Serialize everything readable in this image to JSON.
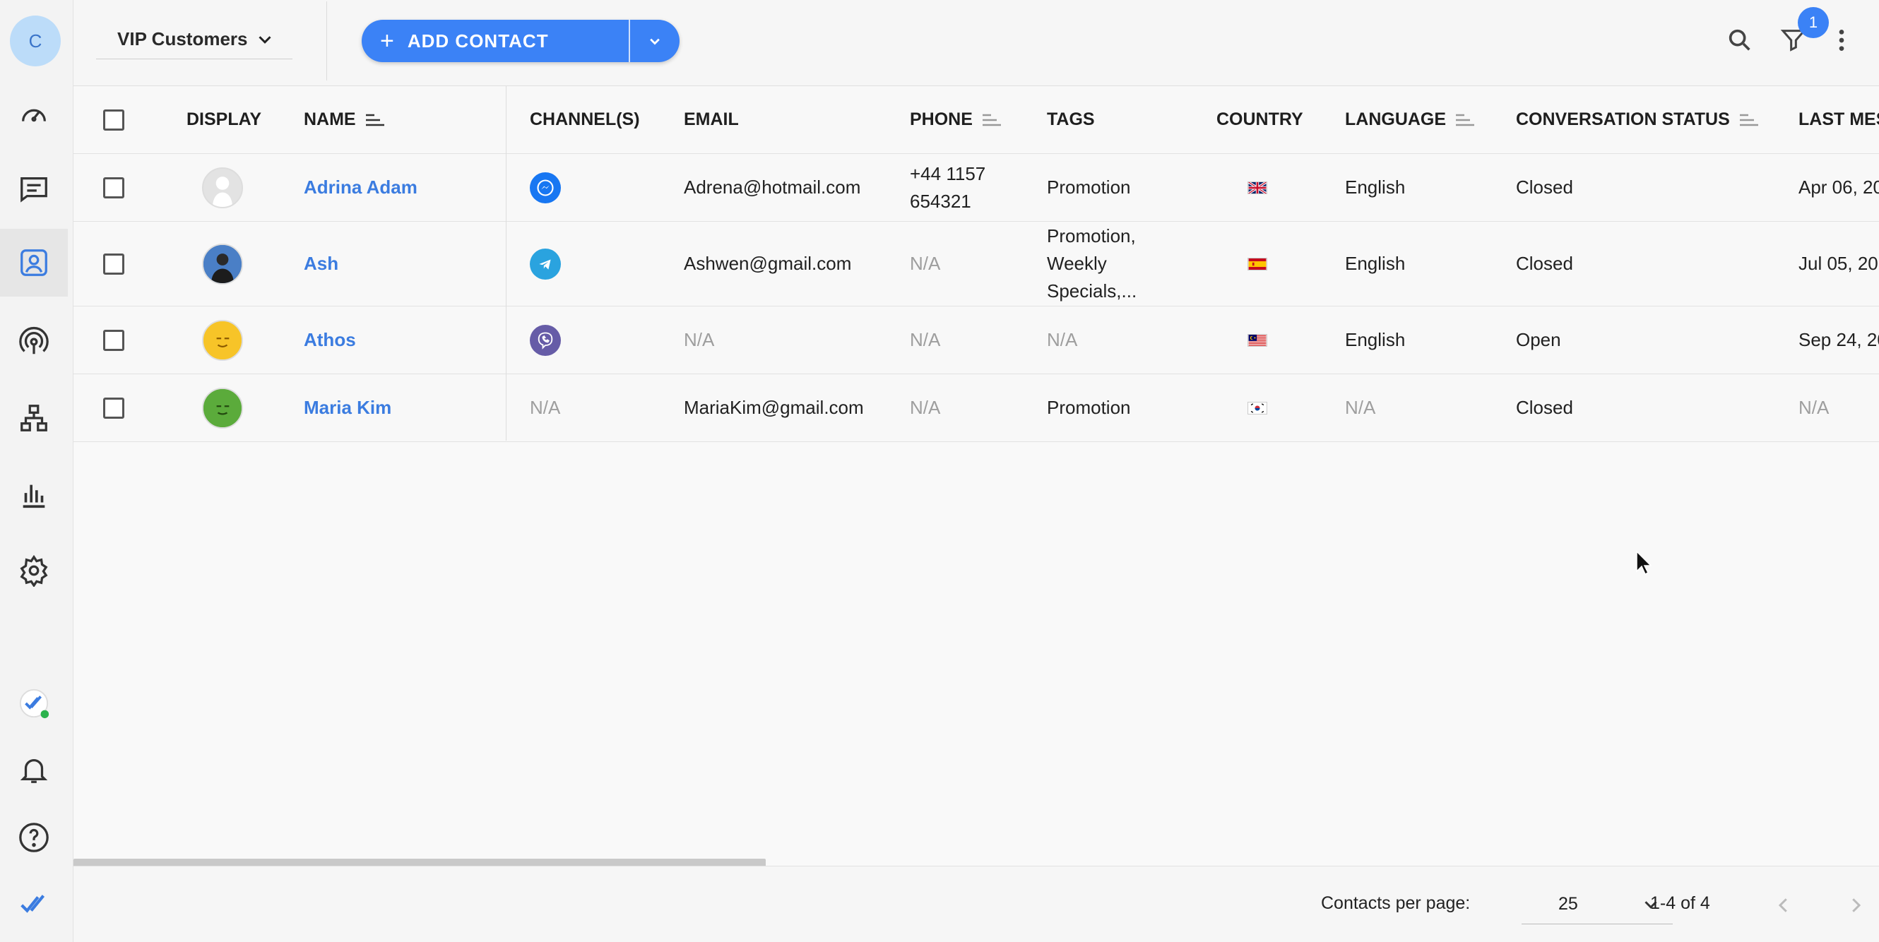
{
  "sidebar": {
    "avatar_initial": "C",
    "items": [
      "dashboard",
      "inbox",
      "contacts",
      "broadcasts",
      "workflows",
      "reports",
      "settings"
    ],
    "bottom": [
      "status",
      "notifications",
      "help",
      "brand"
    ]
  },
  "topbar": {
    "view_label": "VIP Customers",
    "add_contact_label": "ADD CONTACT",
    "filter_badge": "1"
  },
  "table": {
    "headers": {
      "display": "DISPLAY",
      "name": "NAME",
      "channels": "CHANNEL(S)",
      "email": "EMAIL",
      "phone": "PHONE",
      "tags": "TAGS",
      "country": "COUNTRY",
      "language": "LANGUAGE",
      "status": "CONVERSATION STATUS",
      "last": "LAST MES"
    },
    "rows": [
      {
        "name": "Adrina Adam",
        "channel": "messenger",
        "email": "Adrena@hotmail.com",
        "phone": "+44 1157 654321",
        "tags": "Promotion",
        "country": "gb",
        "language": "English",
        "status": "Closed",
        "last": "Apr 06, 20"
      },
      {
        "name": "Ash",
        "channel": "telegram",
        "email": "Ashwen@gmail.com",
        "phone": "N/A",
        "tags": "Promotion, Weekly Specials,...",
        "country": "es",
        "language": "English",
        "status": "Closed",
        "last": "Jul 05, 20"
      },
      {
        "name": "Athos",
        "channel": "viber",
        "email": "N/A",
        "phone": "N/A",
        "tags": "N/A",
        "country": "my",
        "language": "English",
        "status": "Open",
        "last": "Sep 24, 20"
      },
      {
        "name": "Maria Kim",
        "channel": "N/A",
        "email": "MariaKim@gmail.com",
        "phone": "N/A",
        "tags": "Promotion",
        "country": "kr",
        "language": "N/A",
        "status": "Closed",
        "last": "N/A"
      }
    ]
  },
  "footer": {
    "per_page_label": "Contacts per page:",
    "per_page_value": "25",
    "range": "1-4 of 4"
  },
  "colors": {
    "accent": "#3b82f6",
    "link": "#3b7ce0"
  }
}
